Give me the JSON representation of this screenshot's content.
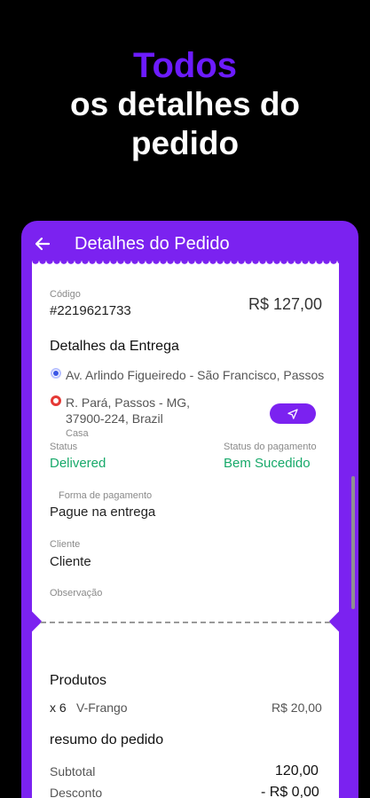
{
  "promo": {
    "line1": "Todos",
    "line2": "os detalhes do",
    "line3": "pedido"
  },
  "appbar": {
    "title": "Detalhes do Pedido"
  },
  "order": {
    "code_label": "Código",
    "code": "#2219621733",
    "total": "R$ 127,00"
  },
  "delivery": {
    "heading": "Detalhes da Entrega",
    "origin": "Av. Arlindo Figueiredo - São Francisco, Passos",
    "destination_line1": "R. Pará, Passos - MG,",
    "destination_line2": "37900-224, Brazil",
    "destination_tag": "Casa"
  },
  "status": {
    "label": "Status",
    "value": "Delivered"
  },
  "payment_status": {
    "label": "Status do pagamento",
    "value": "Bem Sucedido"
  },
  "payment_method": {
    "label": "Forma de pagamento",
    "value": "Pague na entrega"
  },
  "customer": {
    "label": "Cliente",
    "value": "Cliente"
  },
  "note": {
    "label": "Observação"
  },
  "products": {
    "heading": "Produtos",
    "items": [
      {
        "qty": "x 6",
        "name": "V-Frango",
        "price": "R$ 20,00"
      }
    ]
  },
  "summary": {
    "heading": "resumo do pedido",
    "subtotal_label": "Subtotal",
    "subtotal": "120,00",
    "discount_label": "Desconto",
    "discount": "- R$ 0,00"
  },
  "colors": {
    "accent": "#7b22f0",
    "promo_accent": "#6c1bff",
    "success": "#17a96a"
  }
}
